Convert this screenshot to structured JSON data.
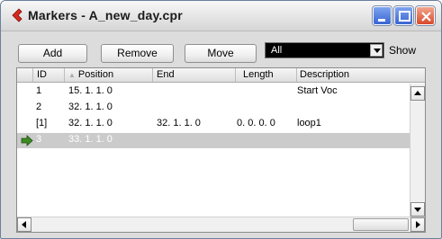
{
  "window": {
    "title": "Markers - A_new_day.cpr",
    "accent_color": "#3865d2",
    "close_color": "#d8492a",
    "icon": "cubase-icon"
  },
  "toolbar": {
    "add_label": "Add",
    "remove_label": "Remove",
    "move_label": "Move",
    "filter_value": "All",
    "show_label": "Show"
  },
  "columns": [
    "ID",
    "Position",
    "End",
    "Length",
    "Description"
  ],
  "rows": [
    {
      "id": "1",
      "position": "15. 1. 1.   0",
      "end": "",
      "length": "",
      "description": "Start Voc",
      "selected": false
    },
    {
      "id": "2",
      "position": "32. 1. 1.   0",
      "end": "",
      "length": "",
      "description": "",
      "selected": false
    },
    {
      "id": "[1]",
      "position": "32. 1. 1.   0",
      "end": "32. 1. 1.   0",
      "length": "0. 0. 0.   0",
      "description": "loop1",
      "selected": false
    },
    {
      "id": "3",
      "position": "33. 1. 1.   0",
      "end": "",
      "length": "",
      "description": "",
      "selected": true
    }
  ]
}
